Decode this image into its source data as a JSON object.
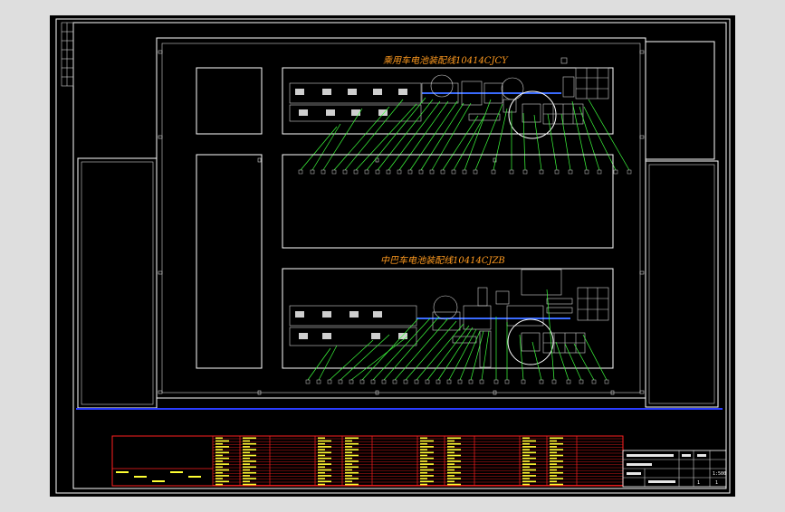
{
  "drawing": {
    "upper_line_title": "乘用车电池装配线10414CJCY",
    "lower_line_title": "中巴车电池装配线10414CJZB"
  },
  "title_block": {
    "scale": "1:500",
    "sheet": "1",
    "sheets": "1"
  },
  "colors": {
    "sheet_bg": "#000000",
    "frame": "#ffffff",
    "leader": "#3dff3d",
    "title": "#ff9a1f",
    "table_line": "#ff2020",
    "table_text": "#ffff33",
    "ground_line": "#2a3cff",
    "equipment_accent": "#3a6bff"
  },
  "icons": {
    "left_margin_strip": "zone-grid-icon",
    "robot": "robot-cell-icon"
  }
}
